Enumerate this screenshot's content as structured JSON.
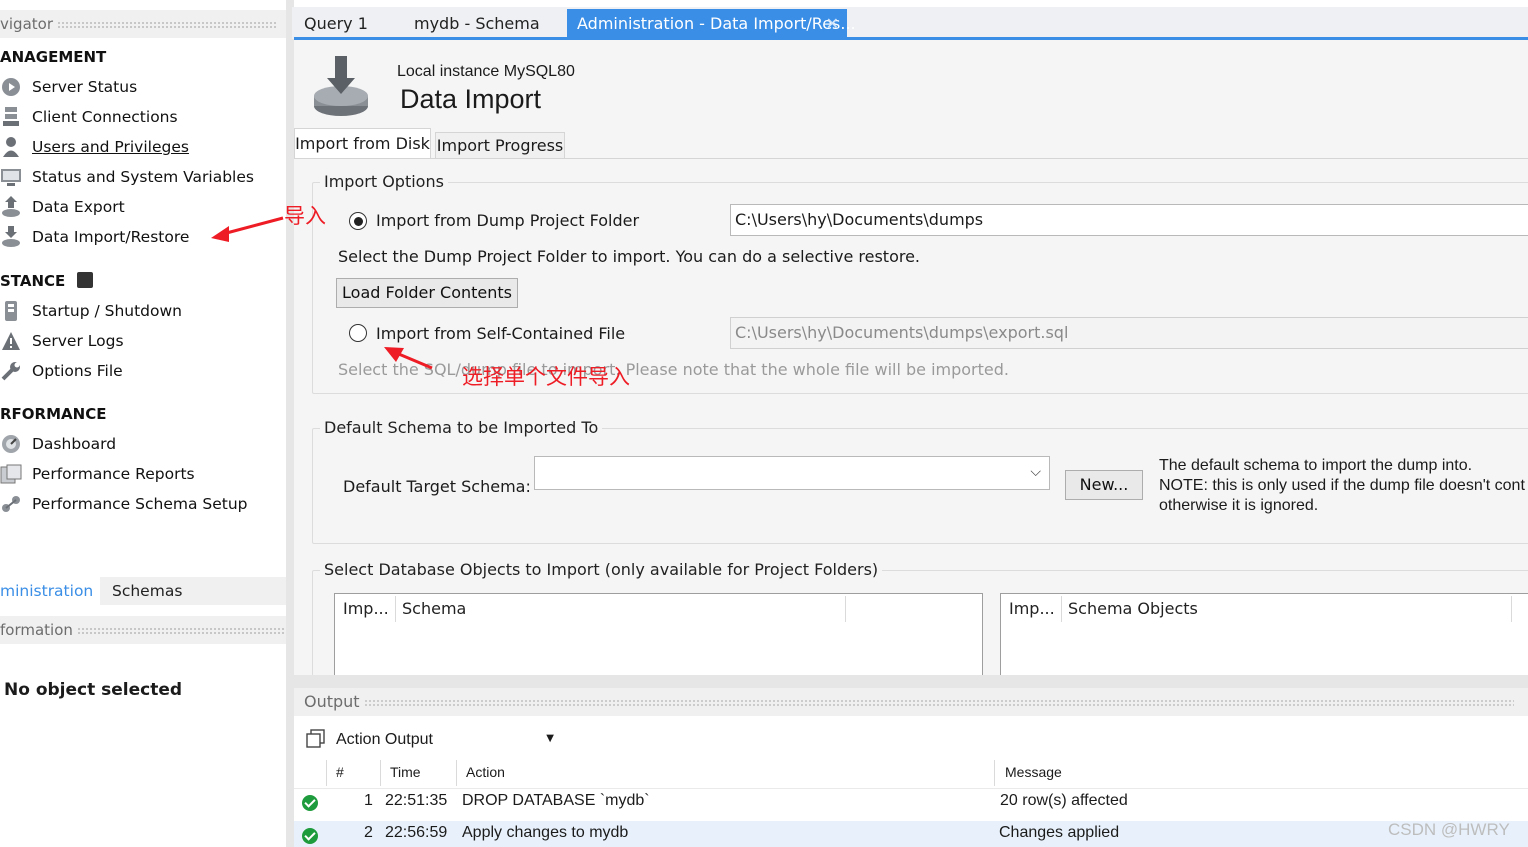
{
  "sidebar": {
    "navigator_title": "vigator",
    "management_title": "ANAGEMENT",
    "management_items": [
      {
        "label": "Server Status",
        "icon": "server-status-icon"
      },
      {
        "label": "Client Connections",
        "icon": "client-connections-icon"
      },
      {
        "label": "Users and Privileges",
        "icon": "user-icon"
      },
      {
        "label": "Status and System Variables",
        "icon": "monitor-icon"
      },
      {
        "label": "Data Export",
        "icon": "data-export-icon"
      },
      {
        "label": "Data Import/Restore",
        "icon": "data-import-icon"
      }
    ],
    "instance_title": "STANCE",
    "instance_items": [
      {
        "label": "Startup / Shutdown",
        "icon": "startup-icon"
      },
      {
        "label": "Server Logs",
        "icon": "warning-icon"
      },
      {
        "label": "Options File",
        "icon": "wrench-icon"
      }
    ],
    "performance_title": "RFORMANCE",
    "performance_items": [
      {
        "label": "Dashboard",
        "icon": "dashboard-icon"
      },
      {
        "label": "Performance Reports",
        "icon": "reports-icon"
      },
      {
        "label": "Performance Schema Setup",
        "icon": "schema-setup-icon"
      }
    ],
    "bottom_tabs": [
      "ministration",
      "Schemas"
    ],
    "information_title": "formation",
    "no_object": "No object selected"
  },
  "tabs": [
    "Query 1",
    "mydb - Schema",
    "Administration - Data Import/Res..."
  ],
  "header": {
    "instance": "Local instance MySQL80",
    "title": "Data Import"
  },
  "subtabs": [
    "Import from Disk",
    "Import Progress"
  ],
  "import_options": {
    "title": "Import Options",
    "option1_label": "Import from Dump Project Folder",
    "option1_path": "C:\\Users\\hy\\Documents\\dumps",
    "option1_hint": "Select the Dump Project Folder to import. You can do a selective restore.",
    "load_button": "Load Folder Contents",
    "option2_label": "Import from Self-Contained File",
    "option2_path": "C:\\Users\\hy\\Documents\\dumps\\export.sql",
    "option2_hint": "Select the SQL/dump file to import. Please note that the whole file will be imported."
  },
  "default_schema": {
    "title": "Default Schema to be Imported To",
    "label": "Default Target Schema:",
    "selected": "",
    "new_button": "New...",
    "note_line1": "The default schema to import the dump into.",
    "note_line2": "NOTE: this is only used if the dump file doesn't cont",
    "note_line3": "otherwise it is ignored."
  },
  "db_objects": {
    "title": "Select Database Objects to Import (only available for Project Folders)",
    "left_cols": [
      "Imp...",
      "Schema"
    ],
    "right_cols": [
      "Imp...",
      "Schema Objects"
    ]
  },
  "output": {
    "title": "Output",
    "selector": "Action Output",
    "columns": [
      "#",
      "Time",
      "Action",
      "Message"
    ],
    "rows": [
      {
        "num": "1",
        "time": "22:51:35",
        "action": "DROP DATABASE `mydb`",
        "message": "20 row(s) affected"
      },
      {
        "num": "2",
        "time": "22:56:59",
        "action": "Apply changes to mydb",
        "message": "Changes applied"
      }
    ]
  },
  "annotations": {
    "import_note": "导入",
    "single_file_note": "选择单个文件导入"
  },
  "watermark": "CSDN @HWRY",
  "colors": {
    "accent": "#3a8ee6",
    "annotation": "#ee1c25",
    "success": "#1e9b3c"
  }
}
